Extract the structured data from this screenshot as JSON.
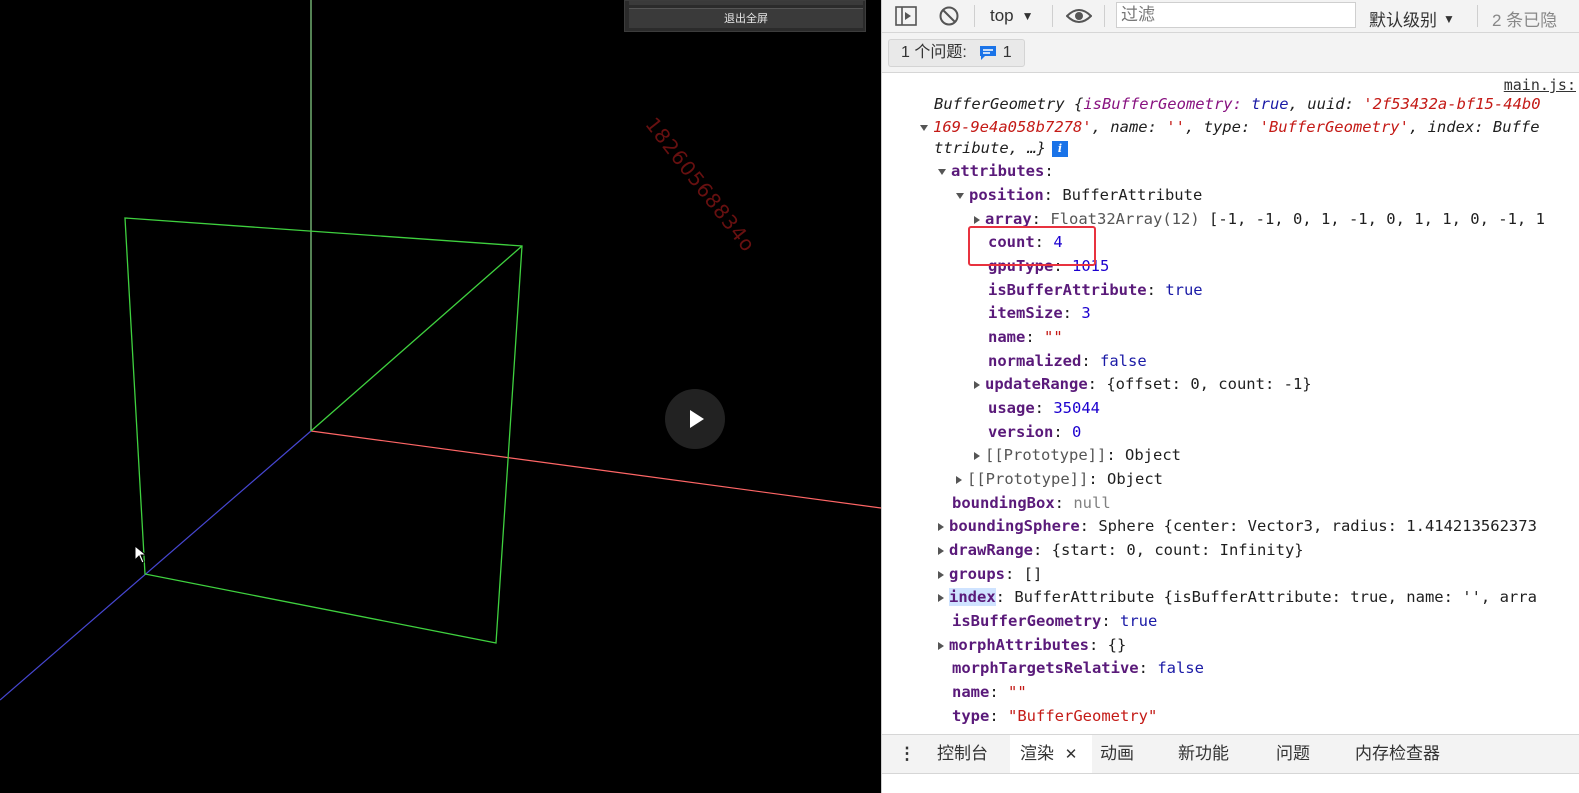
{
  "viewport": {
    "exit_fullscreen_label": "退出全屏",
    "watermark": "18260568834o",
    "colors": {
      "background": "#000000",
      "plane_edges": "#3fd13f",
      "axis_x": "#ff5a5a",
      "axis_y": "#8bd88b",
      "axis_z": "#4a4ad8"
    }
  },
  "devtools": {
    "toolbar": {
      "context": "top",
      "filter_placeholder": "过滤",
      "levels": "默认级别",
      "hidden_count": "2 条已隐"
    },
    "issues": {
      "label": "1 个问题:",
      "count": "1"
    },
    "source_link": "main.js:",
    "console": {
      "header_1a": "BufferGeometry {",
      "header_1b": "isBufferGeometry: ",
      "header_1c": "true",
      "header_1d": ", uuid: ",
      "header_1e": "'2f53432a-bf15-44b0",
      "header_2a": "169-9e4a058b7278'",
      "header_2b": ", name: ",
      "header_2c": "''",
      "header_2d": ", type: ",
      "header_2e": "'BufferGeometry'",
      "header_2f": ", index: Buffe",
      "header_3": "ttribute, …}",
      "attributes_key": "attributes",
      "position_key": "position",
      "position_val": "BufferAttribute",
      "array_key": "array",
      "array_type": "Float32Array(12) ",
      "array_vals": "[-1, -1, 0, 1, -1, 0, 1, 1, 0, -1, 1",
      "count_key": "count",
      "count_val": "4",
      "gputype_key": "gpuType",
      "gputype_val": "1015",
      "isba_key": "isBufferAttribute",
      "isba_val": "true",
      "itemsize_key": "itemSize",
      "itemsize_val": "3",
      "name_key": "name",
      "name_val": "\"\"",
      "normalized_key": "normalized",
      "normalized_val": "false",
      "updaterange_key": "updateRange",
      "updaterange_val": "{offset: 0, count: -1}",
      "usage_key": "usage",
      "usage_val": "35044",
      "version_key": "version",
      "version_val": "0",
      "proto_key": "[[Prototype]]",
      "proto_val": "Object",
      "bbox_key": "boundingBox",
      "bbox_val": "null",
      "bsphere_key": "boundingSphere",
      "bsphere_val": "Sphere {center: Vector3, radius: 1.414213562373",
      "drawrange_key": "drawRange",
      "drawrange_val": "{start: 0, count: Infinity}",
      "groups_key": "groups",
      "groups_val": "[]",
      "index_key": "index",
      "index_val": "BufferAttribute {isBufferAttribute: true, name: '', arra",
      "isbg_key": "isBufferGeometry",
      "isbg_val": "true",
      "morph_key": "morphAttributes",
      "morph_val": "{}",
      "morphrel_key": "morphTargetsRelative",
      "morphrel_val": "false",
      "gname_key": "name",
      "gname_val": "\"\"",
      "type_key": "type",
      "type_val": "\"BufferGeometry\""
    },
    "drawer_tabs": [
      "控制台",
      "渲染",
      "动画",
      "新功能",
      "问题",
      "内存检查器"
    ]
  }
}
